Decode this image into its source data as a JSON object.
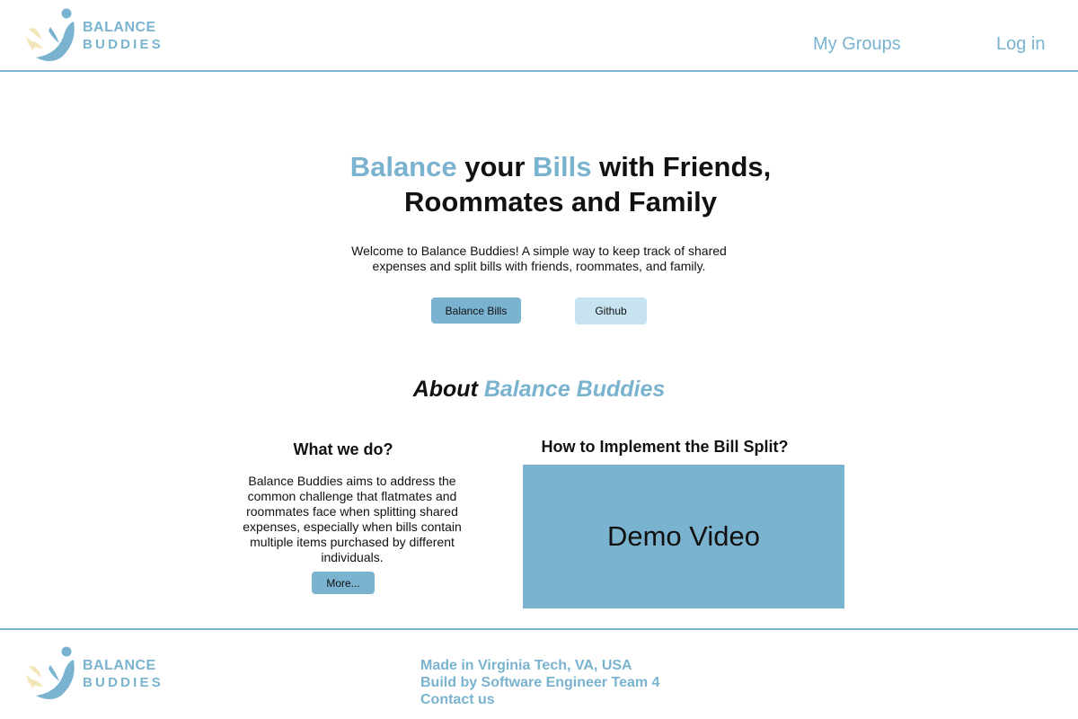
{
  "brand": {
    "name_line1": "BALANCE",
    "name_line2": "BUDDIES",
    "accent_color": "#7ab3cf"
  },
  "nav": {
    "my_groups": "My Groups",
    "login": "Log in"
  },
  "hero": {
    "title_part1": "Balance",
    "title_part2": " your ",
    "title_part3": "Bills",
    "title_part4": " with Friends, Roommates and Family",
    "description": "Welcome to Balance Buddies! A simple way to keep track of shared expenses and split bills with friends, roommates, and family.",
    "primary_button": "Balance Bills",
    "secondary_button": "Github"
  },
  "about": {
    "title_part1": "About ",
    "title_part2": "Balance Buddies",
    "what_title": "What we do?",
    "what_description": "Balance Buddies aims to address the common challenge that flatmates and roommates face when splitting shared expenses, especially when bills contain multiple items purchased by different individuals.",
    "more_button": "More...",
    "how_title": "How to Implement the Bill Split?",
    "demo_label": "Demo Video"
  },
  "footer": {
    "line1": "Made in Virginia Tech, VA, USA",
    "line2": "Build by Software Engineer Team 4",
    "contact": "Contact us"
  }
}
